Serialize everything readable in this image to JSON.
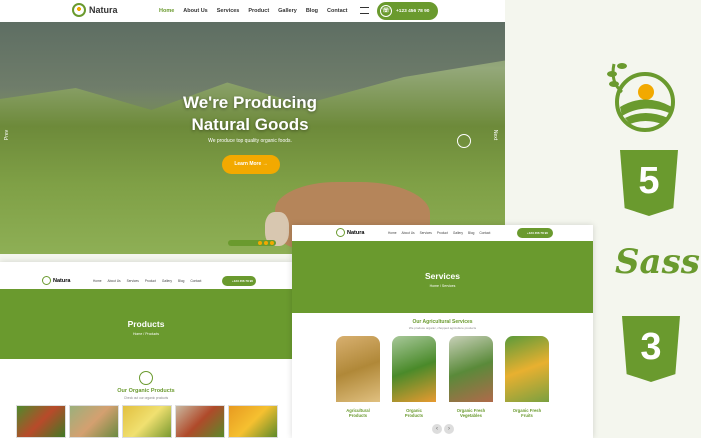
{
  "brand": "Natura",
  "nav": [
    "Home",
    "About Us",
    "Services",
    "Product",
    "Gallery",
    "Blog",
    "Contact"
  ],
  "phone": "+123 456 78 90",
  "hero": {
    "title_line1": "We're Producing",
    "title_line2": "Natural Goods",
    "subtitle": "We produce top quality organic foods.",
    "cta": "Learn More →",
    "prev": "Prev",
    "next": "Next"
  },
  "products_page": {
    "banner_title": "Products",
    "breadcrumb": "Home / Products",
    "section_title": "Our Organic Products",
    "section_sub": "Check out our organic products"
  },
  "services_page": {
    "banner_title": "Services",
    "breadcrumb": "Home / Services",
    "section_title": "Our Agricultural Services",
    "section_sub": "We produce organic, chopped agriculture products",
    "cards": [
      {
        "label_1": "Agricultural",
        "label_2": "Products"
      },
      {
        "label_1": "Organic",
        "label_2": "Products"
      },
      {
        "label_1": "Organic Fresh",
        "label_2": "Vegetables"
      },
      {
        "label_1": "Organic Fresh",
        "label_2": "Fruits"
      }
    ]
  },
  "tech_icons": [
    "leaf-logo-icon",
    "html5-icon",
    "sass-icon",
    "css3-icon"
  ],
  "html5_label": "5",
  "css3_label": "3",
  "sass_label": "Sass",
  "colors": {
    "accent": "#6a9a2e",
    "cta": "#f2a900"
  }
}
